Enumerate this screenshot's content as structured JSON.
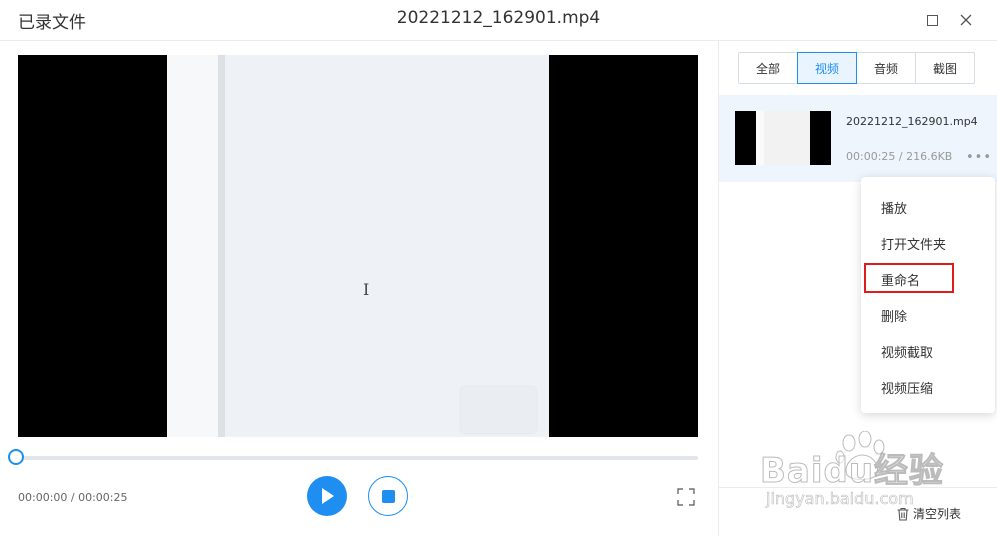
{
  "window": {
    "app_title": "已录文件",
    "file_title": "20221212_162901.mp4"
  },
  "player": {
    "time_readout": "00:00:00 / 00:00:25",
    "progress_fraction": 0.0
  },
  "tabs": [
    {
      "label": "全部",
      "active": false
    },
    {
      "label": "视频",
      "active": true
    },
    {
      "label": "音频",
      "active": false
    },
    {
      "label": "截图",
      "active": false
    }
  ],
  "file": {
    "name": "20221212_162901.mp4",
    "duration": "00:00:25",
    "size": "216.6KB",
    "meta": "00:00:25 / 216.6KB",
    "more_glyph": "•••"
  },
  "menu": {
    "items": [
      "播放",
      "打开文件夹",
      "重命名",
      "删除",
      "视频截取",
      "视频压缩"
    ],
    "highlighted": "重命名"
  },
  "footer": {
    "clear_label": "清空列表"
  },
  "watermark": {
    "main": "Baidu经验",
    "sub": "jingyan.baidu.com"
  },
  "colors": {
    "accent": "#1e8ff0",
    "highlight": "#e01b1b"
  }
}
